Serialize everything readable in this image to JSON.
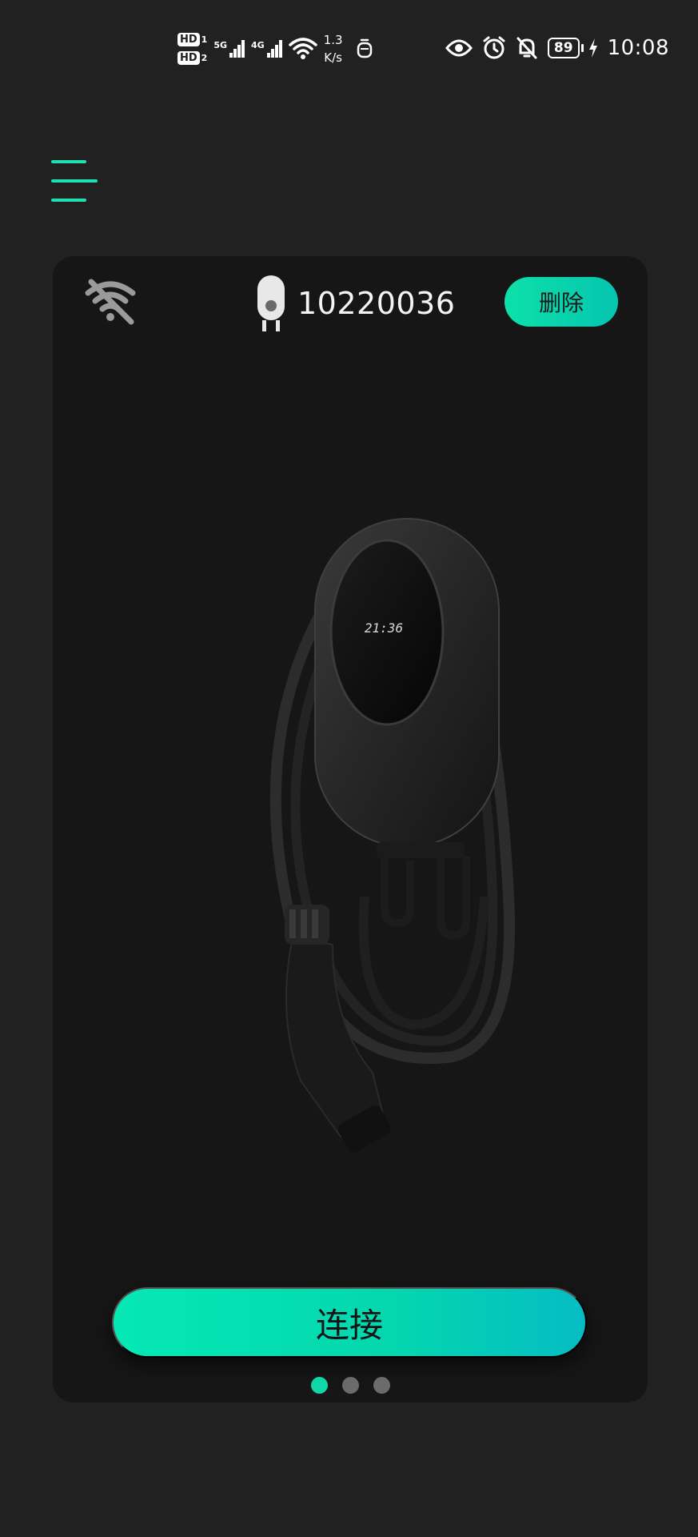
{
  "status_bar": {
    "hd1": "HD",
    "hd1_sub": "1",
    "hd2": "HD",
    "hd2_sub": "2",
    "net1": "5G",
    "net2": "4G",
    "speed_value": "1.3",
    "speed_unit": "K/s",
    "battery": "89",
    "time": "10:08"
  },
  "device": {
    "id": "10220036",
    "wifi_state": "disconnected",
    "delete_label": "删除",
    "screen_text": "21:36"
  },
  "actions": {
    "connect_label": "连接"
  },
  "pager": {
    "count": 3,
    "active_index": 0
  },
  "colors": {
    "background": "#212121",
    "card": "#161616",
    "accent": "#10d6a8"
  }
}
